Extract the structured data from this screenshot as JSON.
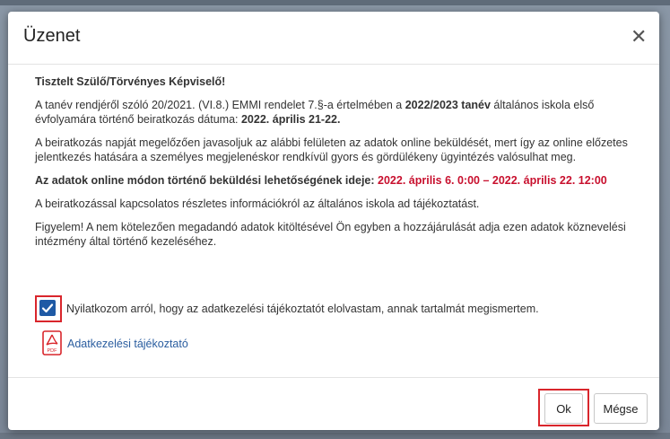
{
  "dialog": {
    "title": "Üzenet",
    "close_icon": "close-icon"
  },
  "content": {
    "greeting": "Tisztelt Szülő/Törvényes Képviselő!",
    "p1_a": "A tanév rendjéről szóló 20/2021. (VI.8.) EMMI rendelet 7.§-a értelmében a ",
    "p1_b": "2022/2023 tanév",
    "p1_c": " általános iskola első évfolyamára történő beiratkozás dátuma: ",
    "p1_d": "2022. április 21-22.",
    "p2": "A beiratkozás napját megelőzően javasoljuk az alábbi felületen az adatok online beküldését, mert így az online előzetes jelentkezés hatására a személyes megjelenéskor rendkívül gyors és gördülékeny ügyintézés valósulhat meg.",
    "p3_label": "Az adatok online módon történő beküldési lehetőségének ideje: ",
    "p3_dates": "2022. április 6. 0:00 – 2022. április 22. 12:00",
    "p4": "A beiratkozással kapcsolatos részletes információkról az általános iskola ad tájékoztatást.",
    "p5": "Figyelem! A nem kötelezően megadandó adatok kitöltésével Ön egyben a hozzájárulását adja ezen adatok köznevelési intézmény által történő kezeléséhez.",
    "consent_label": "Nyilatkozom arról, hogy az adatkezelési tájékoztatót elolvastam, annak tartalmát megismertem.",
    "consent_checked": true,
    "doc_link": "Adatkezelési tájékoztató",
    "doc_icon": "pdf-icon"
  },
  "footer": {
    "ok_label": "Ok",
    "cancel_label": "Mégse"
  },
  "colors": {
    "accent_blue": "#1f5aa5",
    "highlight_red": "#c8102e",
    "link": "#2a5d9f"
  }
}
